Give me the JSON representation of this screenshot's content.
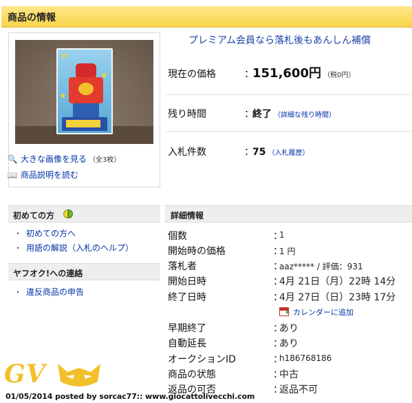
{
  "header": {
    "title": "商品の情報"
  },
  "image_panel": {
    "enlarge_link": "大きな画像を見る",
    "enlarge_count": "（全3枚）",
    "description_link": "商品説明を読む"
  },
  "premium_banner": "プレミアム会員なら落札後もあんしん補償",
  "summary": {
    "price_label": "現在の価格",
    "price_value": "151,600円",
    "price_tax": "（税0円）",
    "time_label": "残り時間",
    "time_value": "終了",
    "time_detail_link": "（詳細な残り時間）",
    "bids_label": "入札件数",
    "bids_value": "75",
    "bids_history_link": "（入札履歴）",
    "colon": "："
  },
  "sidebar": {
    "beginner_title": "初めての方",
    "beginner_links": [
      "初めての方へ",
      "用語の解説（入札のヘルプ）"
    ],
    "contact_title": "ヤフオク!への連絡",
    "contact_links": [
      "違反商品の申告"
    ],
    "bullet": "・"
  },
  "details": {
    "title": "詳細情報",
    "rows": [
      {
        "key": "個数",
        "value": "1"
      },
      {
        "key": "開始時の価格",
        "value": "1 円"
      },
      {
        "key": "落札者",
        "value": "aaz***** / 評価：931"
      },
      {
        "key": "開始日時",
        "value": "4月 21日（月）22時 14分"
      },
      {
        "key": "終了日時",
        "value": "4月 27日（日）23時 17分"
      },
      {
        "key": "早期終了",
        "value": "あり"
      },
      {
        "key": "自動延長",
        "value": "あり"
      },
      {
        "key": "オークションID",
        "value": "h186768186"
      },
      {
        "key": "商品の状態",
        "value": "中古"
      },
      {
        "key": "返品の可否",
        "value": "返品不可"
      }
    ],
    "calendar_link": "カレンダーに追加",
    "colon": "："
  },
  "watermark": {
    "logo_text": "GV"
  },
  "footer": {
    "text": "01/05/2014 posted by sorcac77:: www.giocattolivecchi.com"
  },
  "colors": {
    "header_bar": "#f8d34a",
    "link": "#0033aa",
    "premium": "#1a44a8"
  },
  "icons": [
    "magnifier-icon",
    "book-icon",
    "beginner-leaf-icon",
    "calendar-add-icon"
  ]
}
